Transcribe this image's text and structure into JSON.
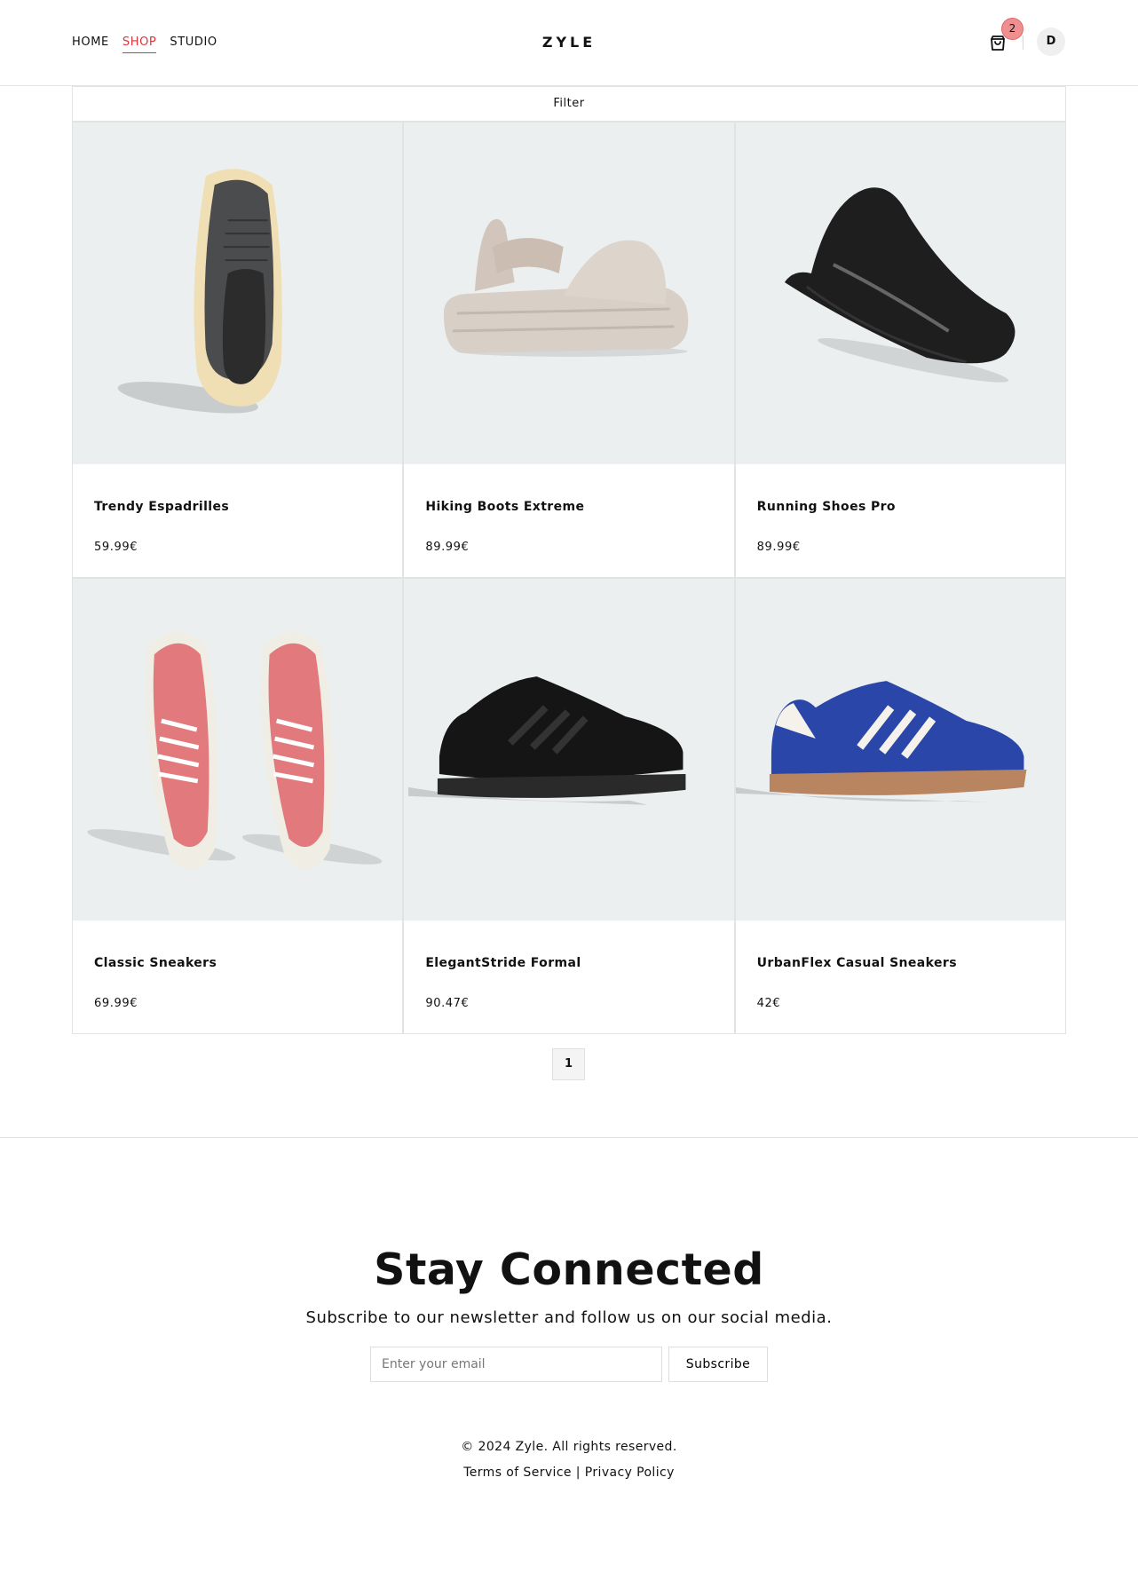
{
  "nav": {
    "items": [
      {
        "label": "HOME",
        "active": false
      },
      {
        "label": "SHOP",
        "active": true
      },
      {
        "label": "STUDIO",
        "active": false
      }
    ]
  },
  "brand": {
    "logo": "ZYLE"
  },
  "cart": {
    "count": "2",
    "icon": "shopping-bag-icon"
  },
  "user": {
    "initial": "D"
  },
  "filter": {
    "label": "Filter"
  },
  "products": [
    {
      "name": "Trendy Espadrilles",
      "price": "59.99€",
      "image": "grey-chunky-sneaker-top-view"
    },
    {
      "name": "Hiking Boots Extreme",
      "price": "89.99€",
      "image": "beige-platform-sandal"
    },
    {
      "name": "Running Shoes Pro",
      "price": "89.99€",
      "image": "black-futuristic-sneaker"
    },
    {
      "name": "Classic Sneakers",
      "price": "69.99€",
      "image": "pink-suede-sneakers-pair"
    },
    {
      "name": "ElegantStride Formal",
      "price": "90.47€",
      "image": "black-suede-sneaker"
    },
    {
      "name": "UrbanFlex Casual Sneakers",
      "price": "42€",
      "image": "blue-suede-sneaker-gum-sole"
    }
  ],
  "pagination": {
    "current": "1"
  },
  "newsletter": {
    "title": "Stay Connected",
    "subtitle": "Subscribe to our newsletter and follow us on our social media.",
    "placeholder": "Enter your email",
    "button": "Subscribe"
  },
  "footer": {
    "copyright": "© 2024 Zyle. All rights reserved.",
    "terms": "Terms of Service",
    "separator": " | ",
    "privacy": "Privacy Policy"
  },
  "colors": {
    "accent": "#e0323a",
    "badge": "#f08f8f",
    "card_bg": "#ebeff0"
  }
}
